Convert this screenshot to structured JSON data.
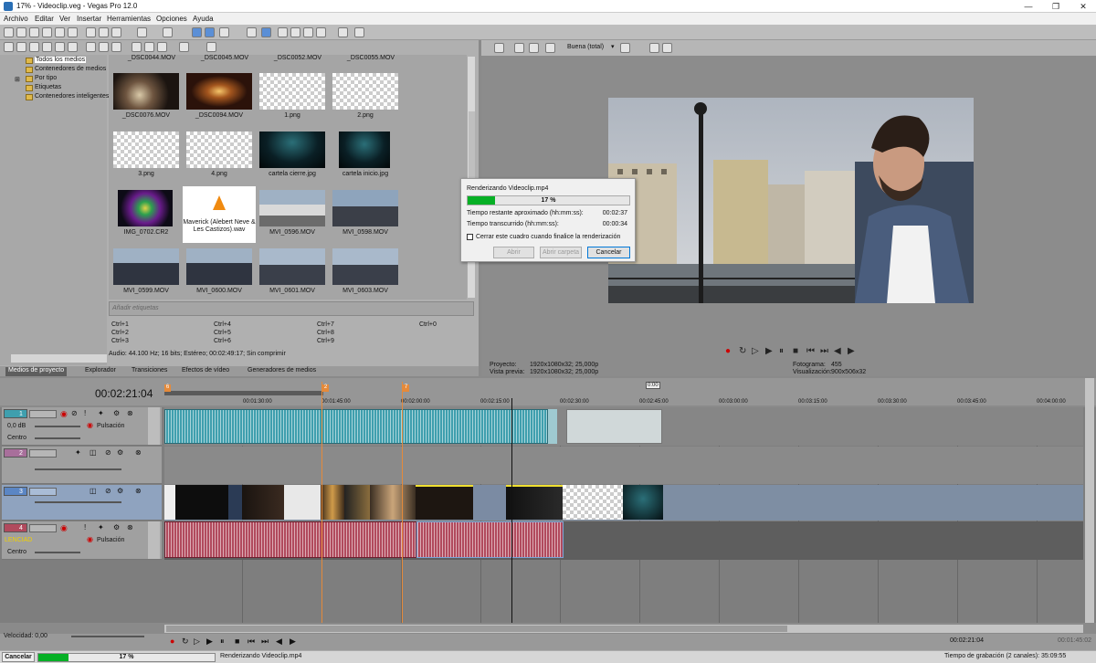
{
  "window": {
    "title": "17% - Videoclip.veg - Vegas Pro 12.0",
    "minimize": "—",
    "maximize": "❐",
    "close": "✕"
  },
  "menu": [
    "Archivo",
    "Editar",
    "Ver",
    "Insertar",
    "Herramientas",
    "Opciones",
    "Ayuda"
  ],
  "media_tree": [
    "Todos los medios",
    "Contenedores de medios",
    "Por tipo",
    "Etiquetas",
    "Contenedores inteligentes"
  ],
  "media_top_captions": [
    "_DSC0044.MOV",
    "_DSC0045.MOV",
    "_DSC0052.MOV",
    "_DSC0055.MOV"
  ],
  "media_items": [
    {
      "name": "_DSC0076.MOV",
      "kind": "dj"
    },
    {
      "name": "_DSC0094.MOV",
      "kind": "fire"
    },
    {
      "name": "1.png",
      "kind": "png"
    },
    {
      "name": "2.png",
      "kind": "png"
    },
    {
      "name": "3.png",
      "kind": "png"
    },
    {
      "name": "4.png",
      "kind": "png"
    },
    {
      "name": "cartela cierre.jpg",
      "kind": "title"
    },
    {
      "name": "cartela inicio.jpg",
      "kind": "title"
    },
    {
      "name": "IMG_0702.CR2",
      "kind": "neon"
    },
    {
      "name": "Maverick (Alebert Neve & Les Castizos).wav",
      "kind": "audio"
    },
    {
      "name": "MVI_0596.MOV",
      "kind": "street"
    },
    {
      "name": "MVI_0598.MOV",
      "kind": "people"
    },
    {
      "name": "MVI_0599.MOV",
      "kind": "people"
    },
    {
      "name": "MVI_0600.MOV",
      "kind": "people"
    },
    {
      "name": "MVI_0601.MOV",
      "kind": "people"
    },
    {
      "name": "MVI_0603.MOV",
      "kind": "people"
    }
  ],
  "tags_placeholder": "Añadir etiquetas",
  "shortcuts": [
    "Ctrl+1",
    "Ctrl+4",
    "Ctrl+7",
    "Ctrl+0",
    "Ctrl+2",
    "Ctrl+5",
    "Ctrl+8",
    "Ctrl+3",
    "Ctrl+6",
    "Ctrl+9"
  ],
  "audio_info": "Audio: 44.100 Hz; 16 bits; Estéreo; 00:02:49:17; Sin comprimir",
  "panel_tabs": [
    "Medios de proyecto",
    "Explorador",
    "Transiciones",
    "Efectos de vídeo",
    "Generadores de medios"
  ],
  "preview": {
    "quality": "Buena (total)",
    "project_label": "Proyecto:",
    "project_value": "1920x1080x32; 25,000p",
    "preview_label": "Vista previa:",
    "preview_value": "1920x1080x32; 25,000p",
    "frame_label": "Fotograma:",
    "frame_value": "455",
    "display_label": "Visualización:",
    "display_value": "900x506x32"
  },
  "render_dialog": {
    "title": "Renderizando Videoclip.mp4",
    "percent_text": "17 %",
    "progress": 0.17,
    "remaining_label": "Tiempo restante aproximado (hh:mm:ss):",
    "remaining_value": "00:02:37",
    "elapsed_label": "Tiempo transcurrido (hh:mm:ss):",
    "elapsed_value": "00:00:34",
    "close_checkbox": "Cerrar este cuadro cuando finalice la renderización",
    "open_button": "Abrir",
    "open_folder_button": "Abrir carpeta",
    "cancel_button": "Cancelar"
  },
  "timeline": {
    "timecode": "00:02:21:04",
    "loop_region_label": "0:00",
    "markers": [
      "6",
      "2",
      "7"
    ],
    "ruler_labels": [
      "00:01:30:00",
      "00:01:45:00",
      "00:02:00:00",
      "00:02:15:00",
      "00:02:30:00",
      "00:02:45:00",
      "00:03:00:00",
      "00:03:15:00",
      "00:03:30:00",
      "00:03:45:00",
      "00:04:00:00"
    ],
    "tracks": [
      {
        "num": "1",
        "type": "audio",
        "vol": "0,0 dB",
        "pan": "Centro",
        "mode": "Pulsación"
      },
      {
        "num": "2",
        "type": "video"
      },
      {
        "num": "3",
        "type": "video"
      },
      {
        "num": "4",
        "type": "audio",
        "label": "LENCIAD",
        "pan": "Centro",
        "mode": "Pulsación"
      }
    ],
    "speed": "Velocidad: 0,00",
    "bottom_timecode": "00:02:21:04",
    "bottom_timecode2": "00:01:45:02"
  },
  "status": {
    "cancel": "Cancelar",
    "percent_text": "17 %",
    "progress": 0.17,
    "message": "Renderizando Videoclip.mp4",
    "record_time": "Tiempo de grabación (2 canales): 35:09:55"
  },
  "colors": {
    "audio_track1": "#3f9fae",
    "audio_track4": "#b14a5d",
    "video_sel": "#5b86c4",
    "progress": "#06b025",
    "marker": "#e58a3a"
  }
}
